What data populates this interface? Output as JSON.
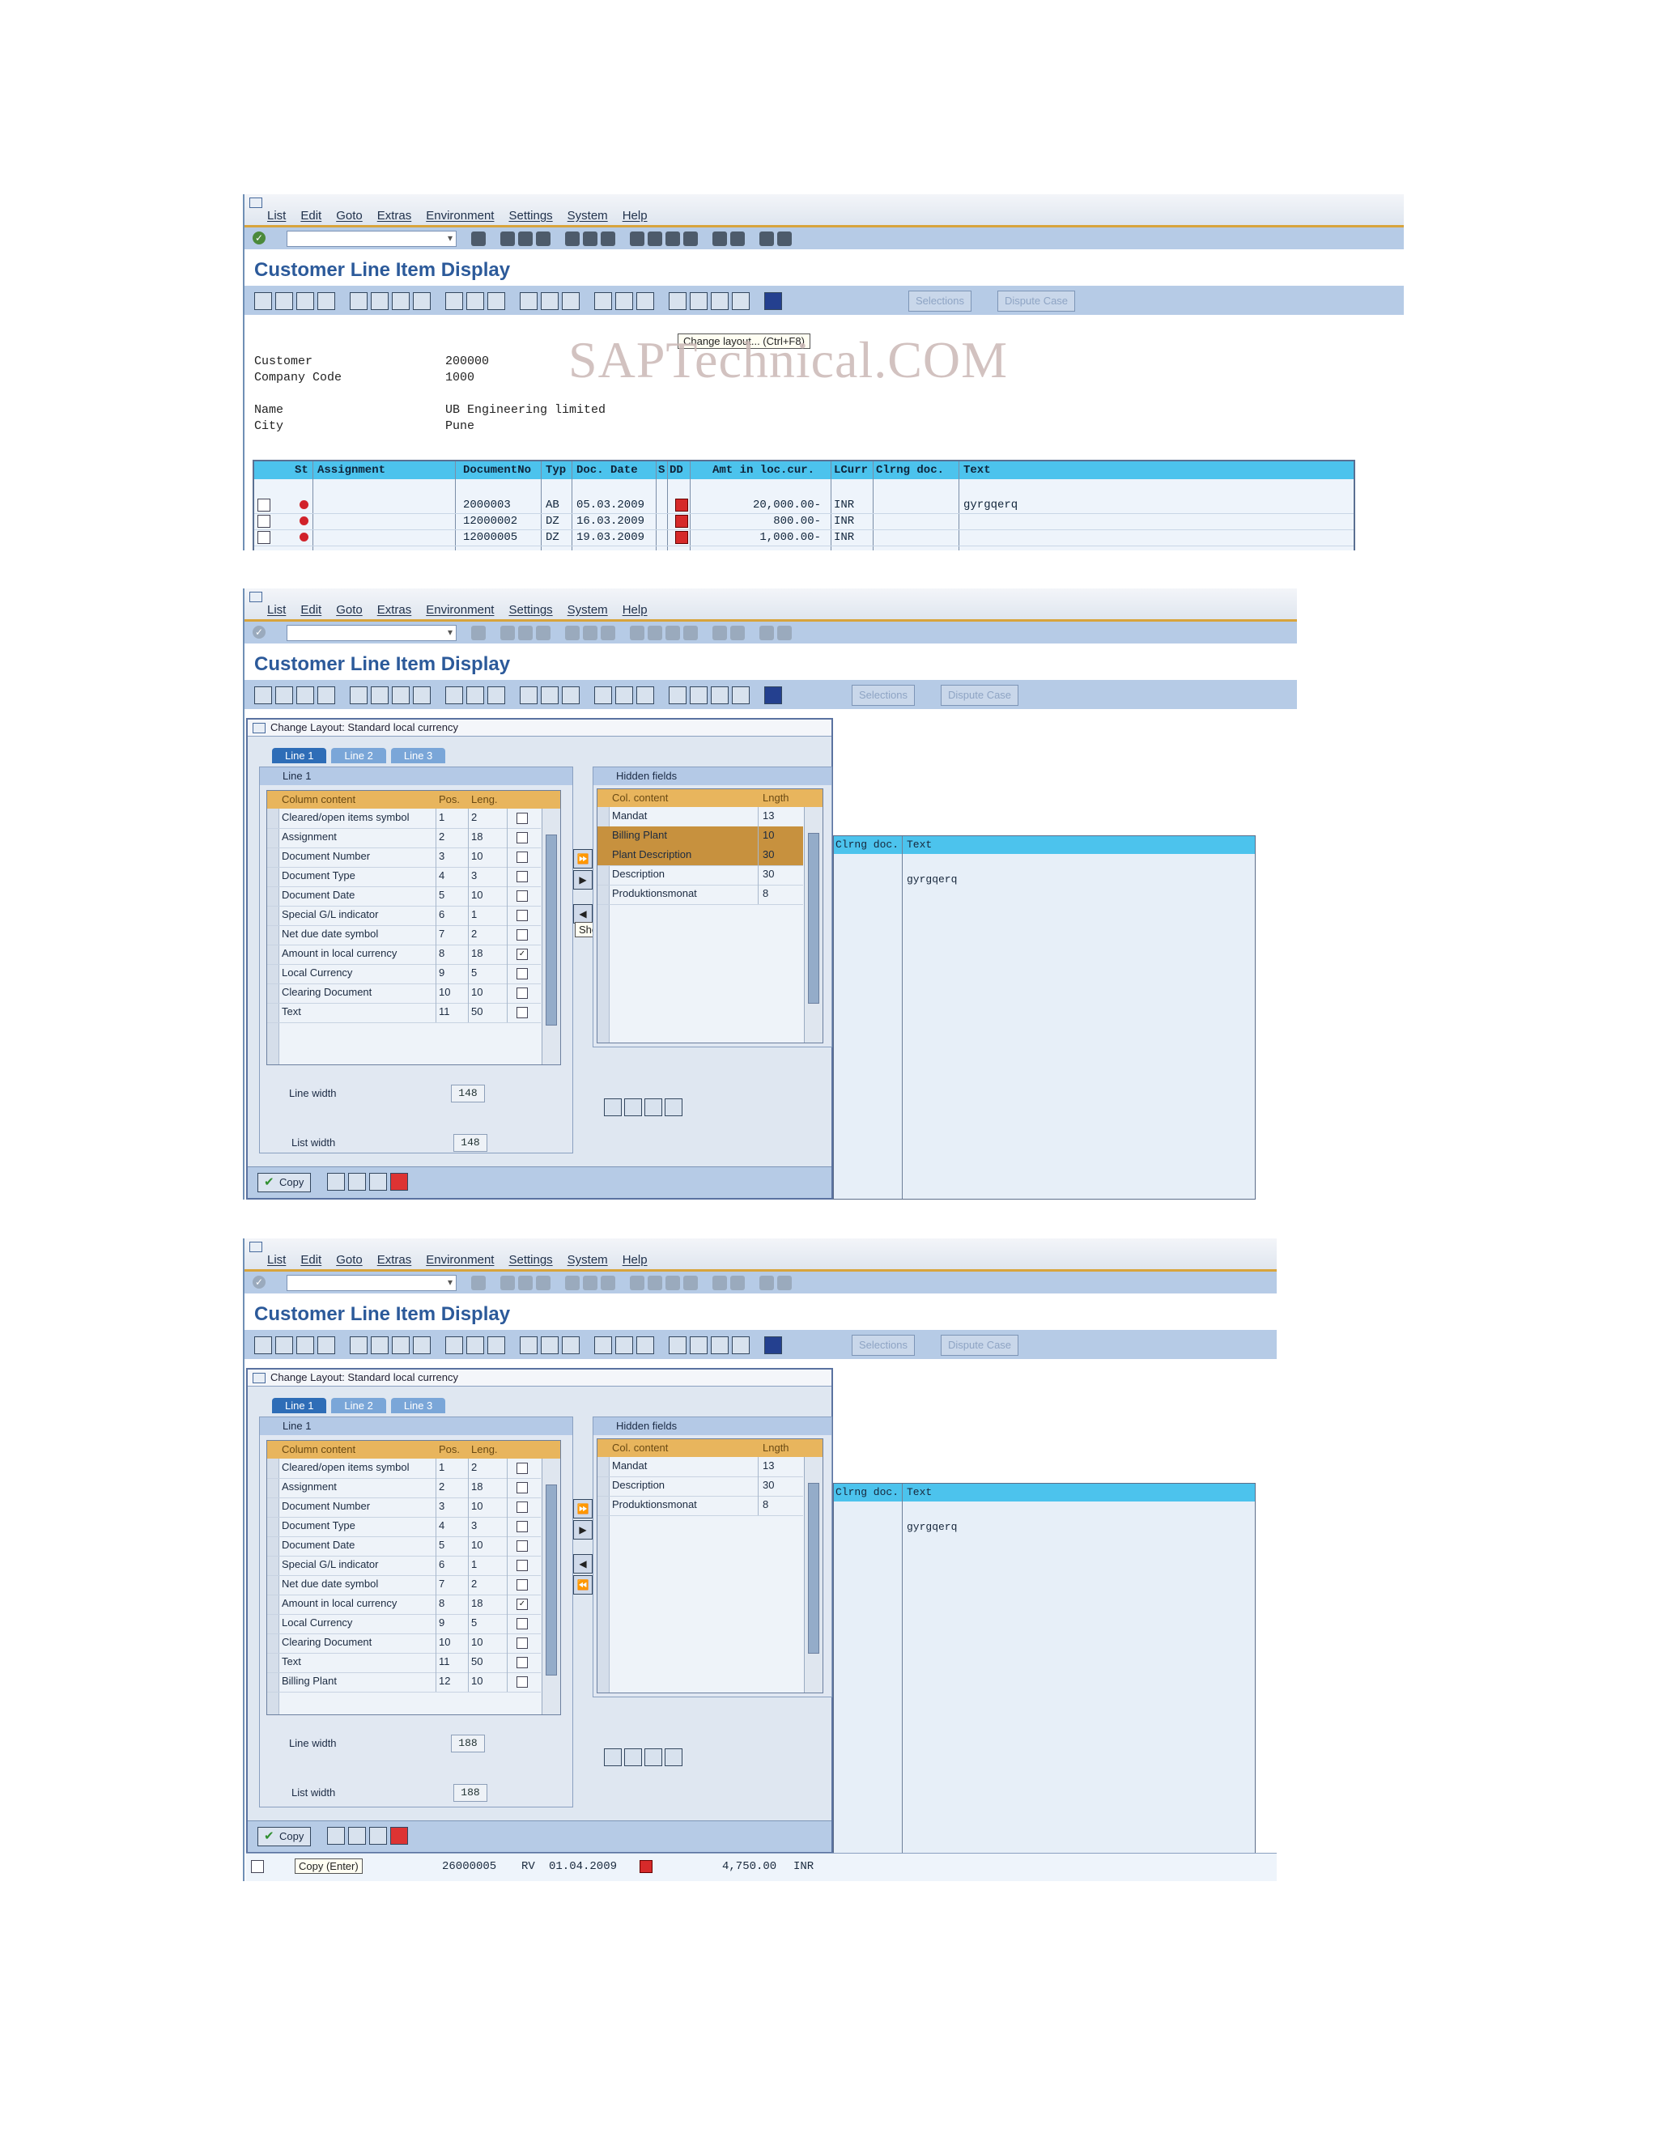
{
  "menu": [
    "List",
    "Edit",
    "Goto",
    "Extras",
    "Environment",
    "Settings",
    "System",
    "Help"
  ],
  "title": "Customer Line Item Display",
  "toolbar_buttons": [
    "Selections",
    "Dispute Case"
  ],
  "screen1": {
    "tooltip": "Change layout...   (Ctrl+F8)",
    "watermark": "SAPTechnical.COM",
    "header_info": [
      {
        "label": "Customer",
        "value": "200000"
      },
      {
        "label": "Company Code",
        "value": "1000"
      },
      {
        "label": "Name",
        "value": "UB Engineering limited"
      },
      {
        "label": "City",
        "value": "Pune"
      }
    ],
    "columns": [
      "St",
      "Assignment",
      "DocumentNo",
      "Typ",
      "Doc. Date",
      "S",
      "DD",
      "Amt in loc.cur.",
      "LCurr",
      "Clrng doc.",
      "Text"
    ],
    "rows": [
      {
        "doc": "2000003",
        "typ": "AB",
        "date": "05.03.2009",
        "amount": "20,000.00-",
        "curr": "INR",
        "text": "gyrgqerq"
      },
      {
        "doc": "12000002",
        "typ": "DZ",
        "date": "16.03.2009",
        "amount": "800.00-",
        "curr": "INR",
        "text": ""
      },
      {
        "doc": "12000005",
        "typ": "DZ",
        "date": "19.03.2009",
        "amount": "1,000.00-",
        "curr": "INR",
        "text": ""
      }
    ]
  },
  "dialog": {
    "title": "Change Layout: Standard local currency",
    "tabs": [
      "Line 1",
      "Line 2",
      "Line 3"
    ],
    "panel_title": "Line 1",
    "left_headers": [
      "Column content",
      "Pos.",
      "Leng."
    ],
    "hidden_title": "Hidden fields",
    "right_headers": [
      "Col. content",
      "Lngth"
    ],
    "line_width_label": "Line width",
    "list_width_label": "List width",
    "copy_label": "Copy"
  },
  "screen2": {
    "left_rows": [
      {
        "name": "Cleared/open items symbol",
        "pos": "1",
        "len": "2",
        "checked": false
      },
      {
        "name": "Assignment",
        "pos": "2",
        "len": "18",
        "checked": false
      },
      {
        "name": "Document Number",
        "pos": "3",
        "len": "10",
        "checked": false
      },
      {
        "name": "Document Type",
        "pos": "4",
        "len": "3",
        "checked": false
      },
      {
        "name": "Document Date",
        "pos": "5",
        "len": "10",
        "checked": false
      },
      {
        "name": "Special G/L indicator",
        "pos": "6",
        "len": "1",
        "checked": false
      },
      {
        "name": "Net due date symbol",
        "pos": "7",
        "len": "2",
        "checked": false
      },
      {
        "name": "Amount in local currency",
        "pos": "8",
        "len": "18",
        "checked": true
      },
      {
        "name": "Local Currency",
        "pos": "9",
        "len": "5",
        "checked": false
      },
      {
        "name": "Clearing Document",
        "pos": "10",
        "len": "10",
        "checked": false
      },
      {
        "name": "Text",
        "pos": "11",
        "len": "50",
        "checked": false
      }
    ],
    "right_rows": [
      {
        "name": "Mandat",
        "len": "13",
        "hl": false
      },
      {
        "name": "Billing Plant",
        "len": "10",
        "hl": true
      },
      {
        "name": "Plant Description",
        "len": "30",
        "hl": true
      },
      {
        "name": "Description",
        "len": "30",
        "hl": false
      },
      {
        "name": "Produktionsmonat",
        "len": "8",
        "hl": false
      }
    ],
    "line_width": "148",
    "list_width": "148",
    "tooltip": "Show selected fields",
    "bg_headers": [
      "Clrng doc.",
      "Text"
    ],
    "bg_text": "gyrgqerq"
  },
  "screen3": {
    "left_rows": [
      {
        "name": "Cleared/open items symbol",
        "pos": "1",
        "len": "2",
        "checked": false
      },
      {
        "name": "Assignment",
        "pos": "2",
        "len": "18",
        "checked": false
      },
      {
        "name": "Document Number",
        "pos": "3",
        "len": "10",
        "checked": false
      },
      {
        "name": "Document Type",
        "pos": "4",
        "len": "3",
        "checked": false
      },
      {
        "name": "Document Date",
        "pos": "5",
        "len": "10",
        "checked": false
      },
      {
        "name": "Special G/L indicator",
        "pos": "6",
        "len": "1",
        "checked": false
      },
      {
        "name": "Net due date symbol",
        "pos": "7",
        "len": "2",
        "checked": false
      },
      {
        "name": "Amount in local currency",
        "pos": "8",
        "len": "18",
        "checked": true
      },
      {
        "name": "Local Currency",
        "pos": "9",
        "len": "5",
        "checked": false
      },
      {
        "name": "Clearing Document",
        "pos": "10",
        "len": "10",
        "checked": false
      },
      {
        "name": "Text",
        "pos": "11",
        "len": "50",
        "checked": false
      },
      {
        "name": "Billing Plant",
        "pos": "12",
        "len": "10",
        "checked": false
      }
    ],
    "right_rows": [
      {
        "name": "Mandat",
        "len": "13",
        "hl": false
      },
      {
        "name": "Description",
        "len": "30",
        "hl": false
      },
      {
        "name": "Produktionsmonat",
        "len": "8",
        "hl": false
      }
    ],
    "line_width": "188",
    "list_width": "188",
    "bg_headers": [
      "Clrng doc.",
      "Text"
    ],
    "bg_text": "gyrgqerq",
    "copy_tooltip": "Copy  (Enter)",
    "under_row": {
      "doc": "26000005",
      "typ": "RV",
      "date": "01.04.2009",
      "amount": "4,750.00",
      "curr": "INR"
    }
  }
}
